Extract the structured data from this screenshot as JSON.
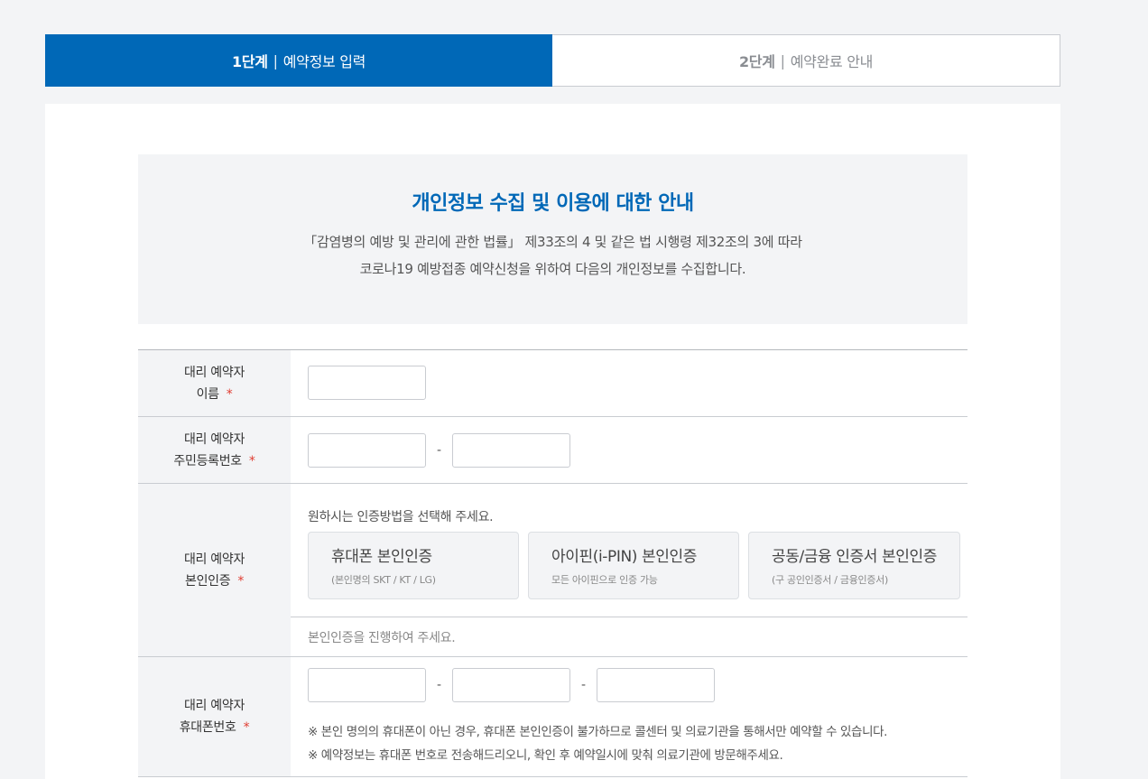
{
  "steps": [
    {
      "num": "1단계",
      "label": "예약정보 입력",
      "active": true
    },
    {
      "num": "2단계",
      "label": "예약완료 안내",
      "active": false
    }
  ],
  "notice": {
    "title": "개인정보 수집 및 이용에 대한 안내",
    "line1": "「감염병의 예방 및 관리에 관한 법률」 제33조의 4 및 같은 법 시행령 제32조의 3에 따라",
    "line2": "코로나19 예방접종 예약신청을 위하여 다음의 개인정보를 수집합니다."
  },
  "form": {
    "name": {
      "label1": "대리 예약자",
      "label2": "이름",
      "required": "*"
    },
    "rrn": {
      "label1": "대리 예약자",
      "label2": "주민등록번호",
      "required": "*",
      "sep": "-"
    },
    "auth": {
      "label1": "대리 예약자",
      "label2": "본인인증",
      "required": "*",
      "hint": "원하시는 인증방법을 선택해 주세요.",
      "options": [
        {
          "title": "휴대폰 본인인증",
          "sub": "(본인명의 SKT / KT / LG)"
        },
        {
          "title": "아이핀(i-PIN) 본인인증",
          "sub": "모든 아이핀으로 인증 가능"
        },
        {
          "title": "공동/금융 인증서 본인인증",
          "sub": "(구 공인인증서 / 금융인증서)"
        }
      ],
      "status": "본인인증을 진행하여 주세요."
    },
    "phone": {
      "label1": "대리 예약자",
      "label2": "휴대폰번호",
      "required": "*",
      "sep": "-",
      "note1": "※ 본인 명의의 휴대폰이 아닌 경우, 휴대폰 본인인증이 불가하므로 콜센터 및 의료기관을 통해서만 예약할 수 있습니다.",
      "note2": "※ 예약정보는 휴대폰 번호로 전송해드리오니, 확인 후 예약일시에 맞춰 의료기관에 방문해주세요."
    }
  }
}
